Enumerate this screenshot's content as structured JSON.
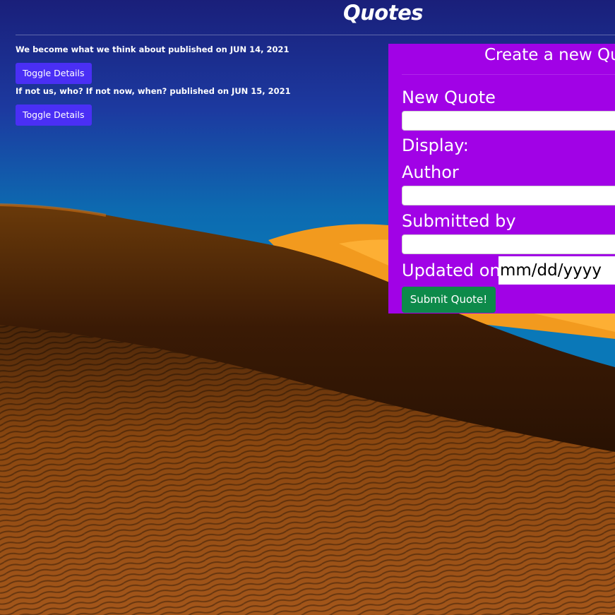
{
  "header": {
    "title": "Quotes"
  },
  "quotes": [
    {
      "text": "We become what we think about published on JUN 14, 2021",
      "toggle_label": "Toggle Details"
    },
    {
      "text": "If not us, who? If not now, when? published on JUN 15, 2021",
      "toggle_label": "Toggle Details"
    }
  ],
  "form": {
    "heading": "Create a new Qu",
    "new_quote_label": "New Quote",
    "display_label": "Display:",
    "author_label": "Author",
    "submitted_by_label": "Submitted by",
    "updated_on_label": "Updated on",
    "date_placeholder": "mm/dd/yyyy",
    "submit_label": "Submit Quote!"
  },
  "colors": {
    "toggle_button": "#4a2ff5",
    "form_panel": "#a102e6",
    "submit_button": "#0d8a4a"
  }
}
